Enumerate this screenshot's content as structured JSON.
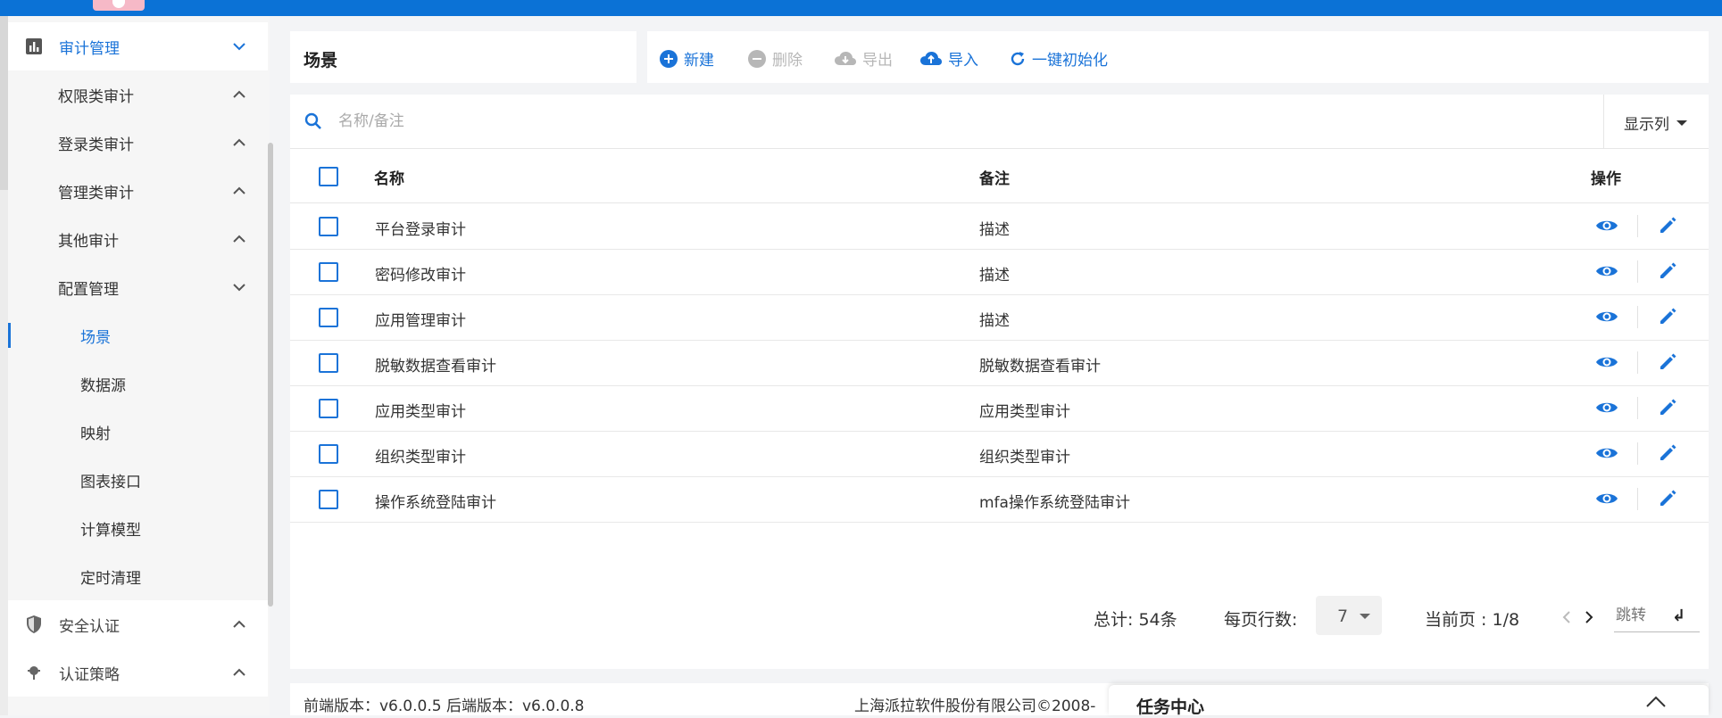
{
  "colors": {
    "primary": "#1a73d8",
    "topbar": "#0b72d6",
    "disabled": "#b7b7b7"
  },
  "sidebar": {
    "audit": {
      "label": "审计管理",
      "icon": "bar-chart-icon",
      "expanded": true
    },
    "items": [
      {
        "label": "权限类审计"
      },
      {
        "label": "登录类审计"
      },
      {
        "label": "管理类审计"
      },
      {
        "label": "其他审计"
      },
      {
        "label": "配置管理"
      }
    ],
    "config_items": [
      {
        "label": "场景",
        "active": true
      },
      {
        "label": "数据源"
      },
      {
        "label": "映射"
      },
      {
        "label": "图表接口"
      },
      {
        "label": "计算模型"
      },
      {
        "label": "定时清理"
      }
    ],
    "security": {
      "label": "安全认证",
      "icon": "shield-icon"
    },
    "policy": {
      "label": "认证策略",
      "icon": "policy-icon"
    }
  },
  "page": {
    "title": "场景"
  },
  "toolbar": {
    "new": "新建",
    "delete": "删除",
    "export": "导出",
    "import": "导入",
    "init": "一键初始化"
  },
  "search": {
    "placeholder": "名称/备注",
    "columns_btn": "显示列"
  },
  "table": {
    "headers": {
      "name": "名称",
      "remark": "备注",
      "action": "操作"
    },
    "rows": [
      {
        "name": "平台登录审计",
        "remark": "描述"
      },
      {
        "name": "密码修改审计",
        "remark": "描述"
      },
      {
        "name": "应用管理审计",
        "remark": "描述"
      },
      {
        "name": "脱敏数据查看审计",
        "remark": "脱敏数据查看审计"
      },
      {
        "name": "应用类型审计",
        "remark": "应用类型审计"
      },
      {
        "name": "组织类型审计",
        "remark": "组织类型审计"
      },
      {
        "name": "操作系统登陆审计",
        "remark": "mfa操作系统登陆审计"
      }
    ]
  },
  "pager": {
    "total": "总计: 54条",
    "per_page_label": "每页行数:",
    "per_page": "7",
    "current": "当前页 : 1/8",
    "jump_placeholder": "跳转"
  },
  "footer": {
    "version": "前端版本：v6.0.0.5 后端版本：v6.0.0.8",
    "company": "上海派拉软件股份有限公司©2008-"
  },
  "task_center": {
    "title": "任务中心"
  }
}
